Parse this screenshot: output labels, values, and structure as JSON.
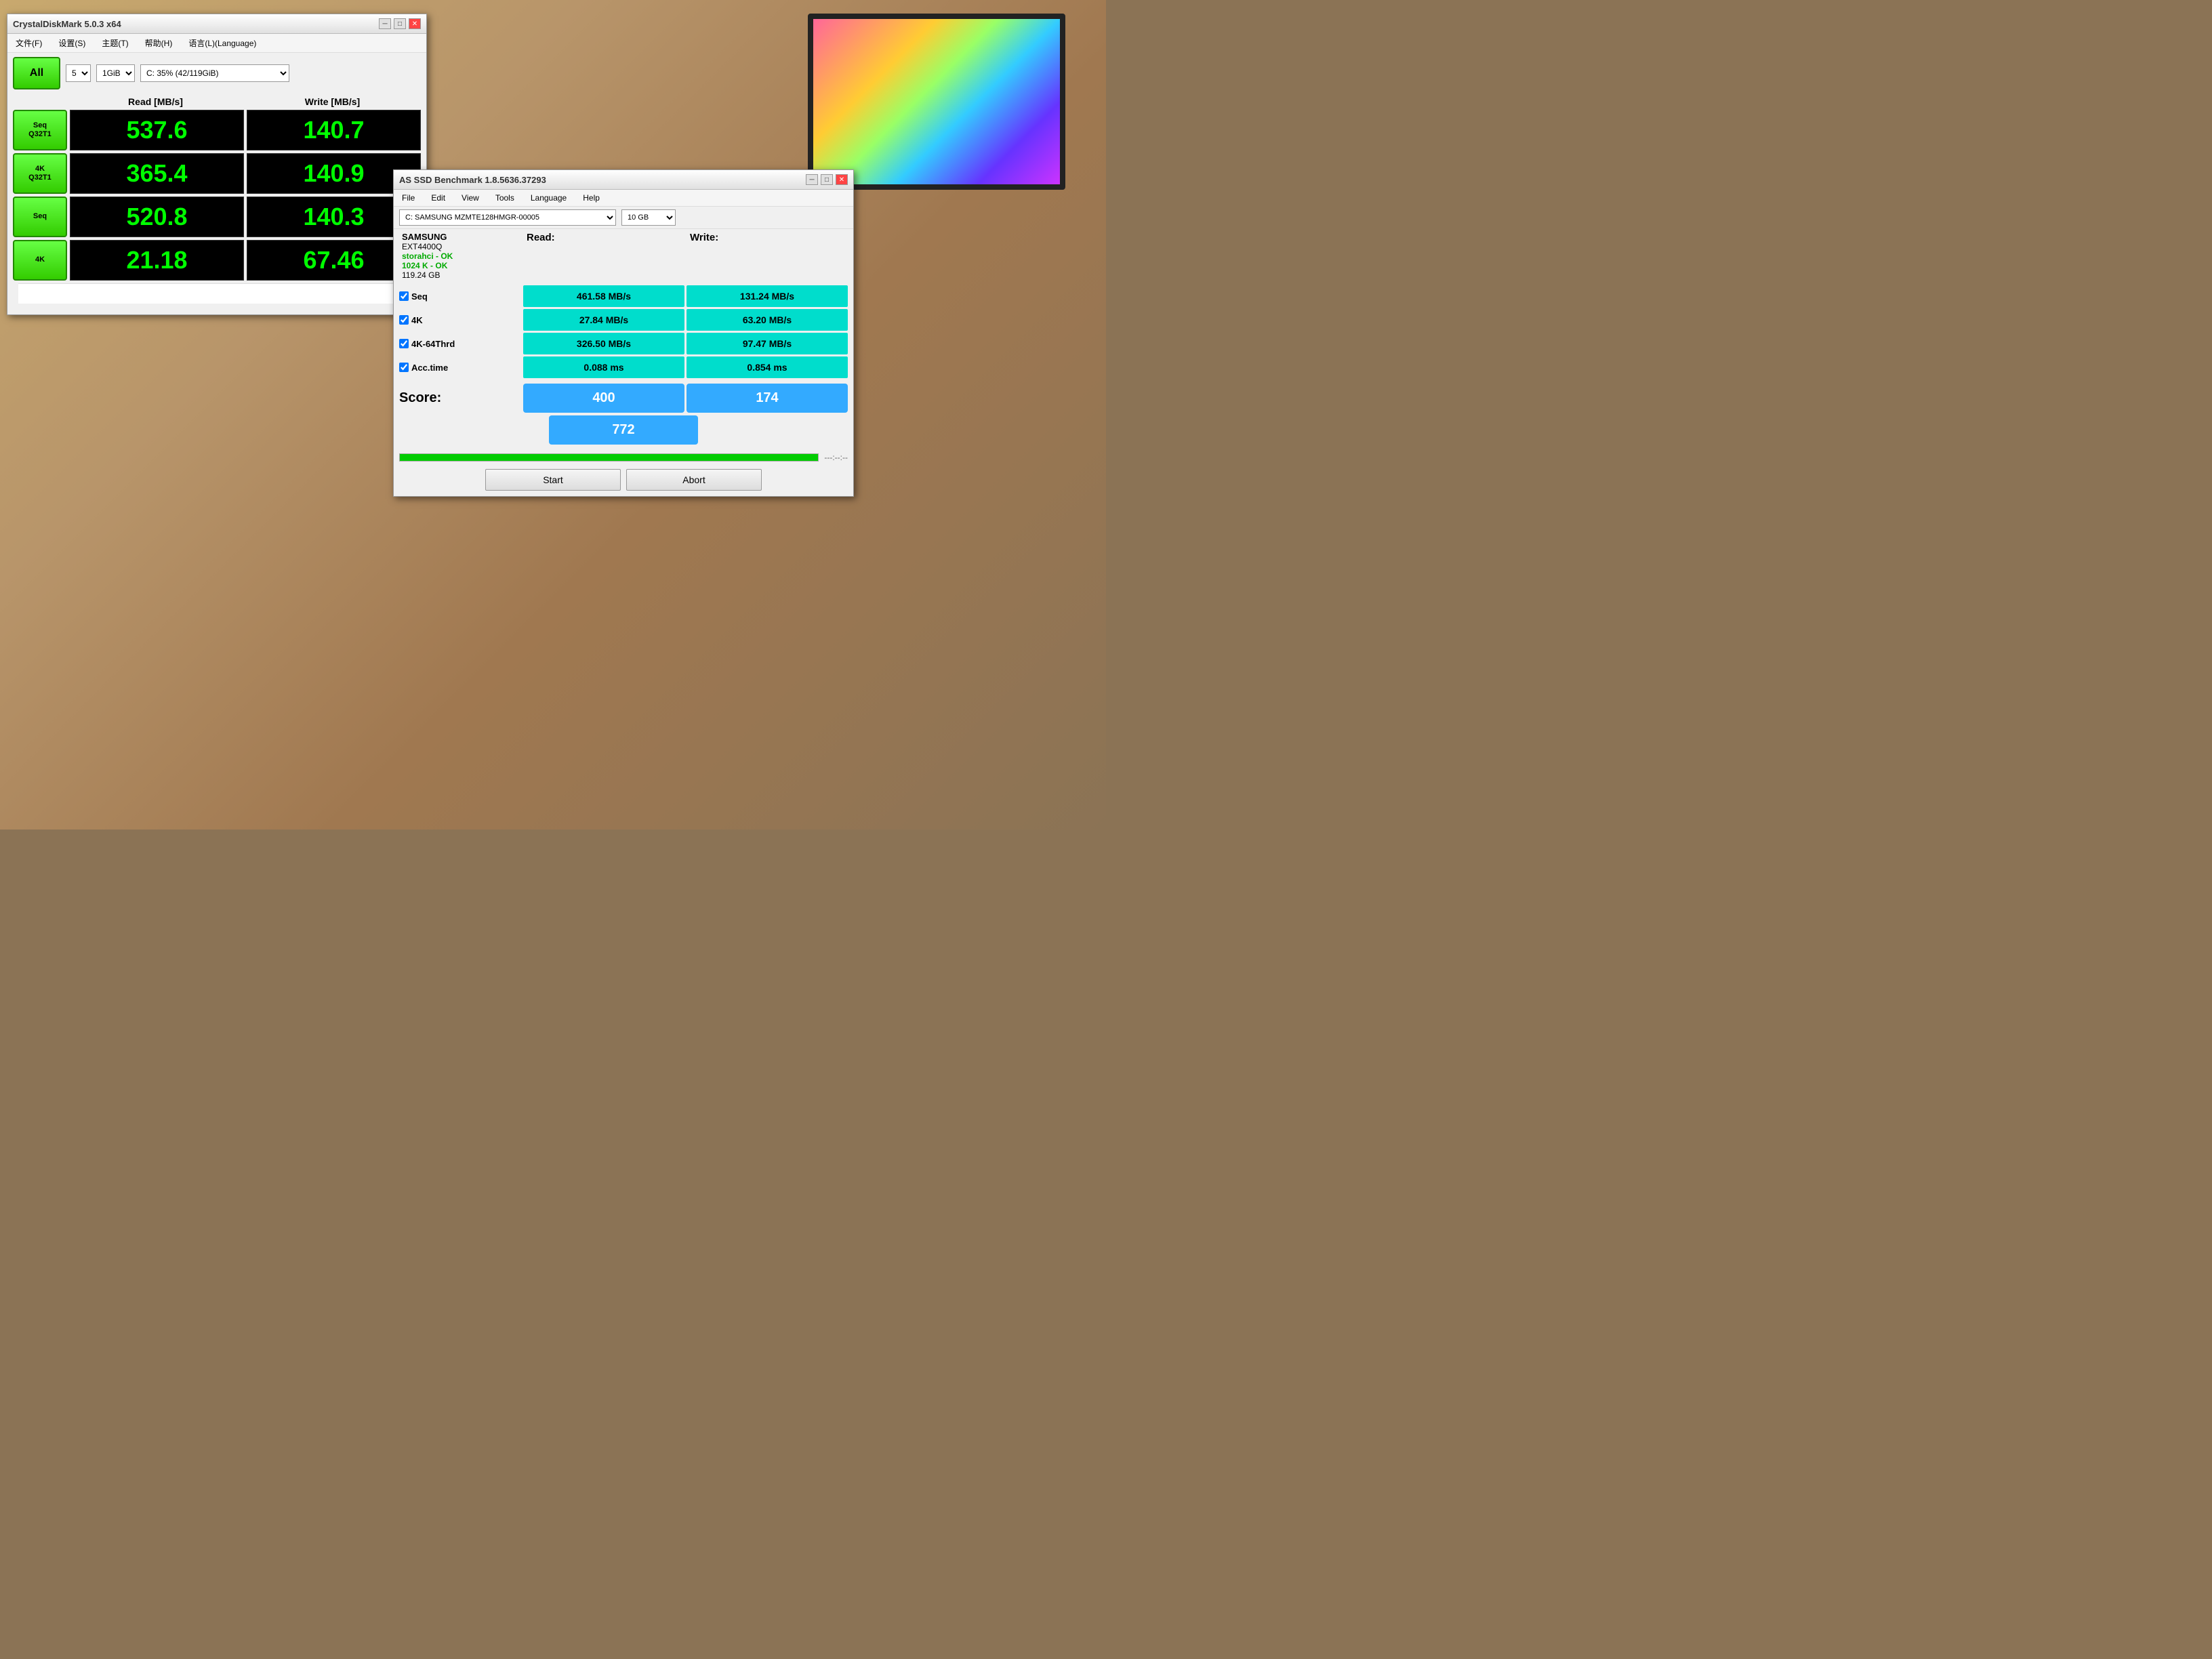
{
  "background": {
    "color": "#8B7355"
  },
  "cdm_window": {
    "title": "CrystalDiskMark 5.0.3 x64",
    "controls": {
      "minimize": "─",
      "maximize": "□",
      "close": "✕"
    },
    "menu": {
      "items": [
        "文件(F)",
        "设置(S)",
        "主题(T)",
        "帮助(H)",
        "语言(L)(Language)"
      ]
    },
    "toolbar": {
      "all_button": "All",
      "count_select": "5",
      "size_select": "1GiB",
      "drive_select": "C: 35% (42/119GiB)"
    },
    "headers": {
      "label": "",
      "read": "Read [MB/s]",
      "write": "Write [MB/s]"
    },
    "rows": [
      {
        "label": "Seq\nQ32T1",
        "read": "537.6",
        "write": "140.7"
      },
      {
        "label": "4K\nQ32T1",
        "read": "365.4",
        "write": "140.9"
      },
      {
        "label": "Seq",
        "read": "520.8",
        "write": "140.3"
      },
      {
        "label": "4K",
        "read": "21.18",
        "write": "67.46"
      }
    ]
  },
  "asssd_window": {
    "title": "AS SSD Benchmark 1.8.5636.37293",
    "controls": {
      "minimize": "─",
      "maximize": "□",
      "close": "✕"
    },
    "menu": {
      "items": [
        "File",
        "Edit",
        "View",
        "Tools",
        "Language",
        "Help"
      ]
    },
    "toolbar": {
      "drive_select": "C: SAMSUNG MZMTE128HMGR-00005",
      "size_select": "10 GB"
    },
    "device_info": {
      "name": "SAMSUNG",
      "model": "EXT4400Q",
      "ahci_status": "storahci - OK",
      "cache_status": "1024 K - OK",
      "size": "119.24 GB"
    },
    "col_headers": {
      "read": "Read:",
      "write": "Write:"
    },
    "rows": [
      {
        "label": "Seq",
        "checked": true,
        "read": "461.58 MB/s",
        "write": "131.24 MB/s"
      },
      {
        "label": "4K",
        "checked": true,
        "read": "27.84 MB/s",
        "write": "63.20 MB/s"
      },
      {
        "label": "4K-64Thrd",
        "checked": true,
        "read": "326.50 MB/s",
        "write": "97.47 MB/s"
      },
      {
        "label": "Acc.time",
        "checked": true,
        "read": "0.088 ms",
        "write": "0.854 ms"
      }
    ],
    "scores": {
      "label": "Score:",
      "read": "400",
      "write": "174",
      "total": "772"
    },
    "progress": {
      "fill_percent": "100",
      "time_display": "---:--:--"
    },
    "buttons": {
      "start": "Start",
      "abort": "Abort"
    }
  }
}
